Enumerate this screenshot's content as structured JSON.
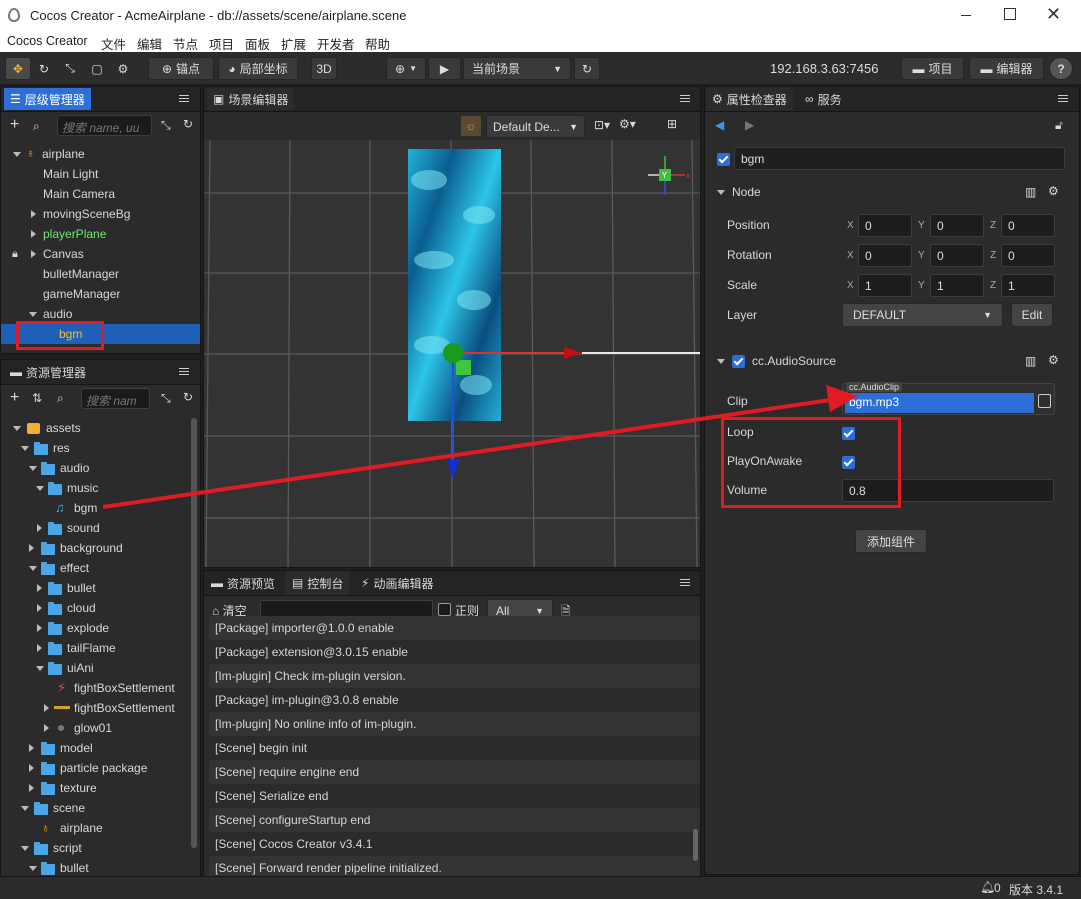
{
  "window": {
    "title": "Cocos Creator - AcmeAirplane - db://assets/scene/airplane.scene"
  },
  "menu": [
    "Cocos Creator",
    "文件",
    "编辑",
    "节点",
    "项目",
    "面板",
    "扩展",
    "开发者",
    "帮助"
  ],
  "toolbar": {
    "anchor": "锚点",
    "local_coords": "局部坐标",
    "mode3d": "3D",
    "scene_select": "当前场景",
    "ip": "192.168.3.63:7456",
    "project": "项目",
    "editor": "编辑器",
    "help": "?"
  },
  "hierarchy": {
    "tab": "层级管理器",
    "search_placeholder": "搜索 name, uu",
    "root": "airplane",
    "items": [
      {
        "label": "Main Light"
      },
      {
        "label": "Main Camera"
      },
      {
        "label": "movingSceneBg"
      },
      {
        "label": "playerPlane"
      },
      {
        "label": "Canvas"
      },
      {
        "label": "bulletManager"
      },
      {
        "label": "gameManager"
      },
      {
        "label": "audio"
      },
      {
        "label": "bgm"
      }
    ]
  },
  "assets": {
    "tab": "资源管理器",
    "search_placeholder": "搜索 nam",
    "items": [
      {
        "label": "assets"
      },
      {
        "label": "res"
      },
      {
        "label": "audio"
      },
      {
        "label": "music"
      },
      {
        "label": "bgm"
      },
      {
        "label": "sound"
      },
      {
        "label": "background"
      },
      {
        "label": "effect"
      },
      {
        "label": "bullet"
      },
      {
        "label": "cloud"
      },
      {
        "label": "explode"
      },
      {
        "label": "tailFlame"
      },
      {
        "label": "uiAni"
      },
      {
        "label": "fightBoxSettlement"
      },
      {
        "label": "fightBoxSettlement"
      },
      {
        "label": "glow01"
      },
      {
        "label": "model"
      },
      {
        "label": "particle package"
      },
      {
        "label": "texture"
      },
      {
        "label": "scene"
      },
      {
        "label": "airplane"
      },
      {
        "label": "script"
      },
      {
        "label": "bullet"
      }
    ]
  },
  "scene_editor": {
    "tab": "场景编辑器",
    "camera_select": "Default De..."
  },
  "bottom": {
    "tabs": [
      "资源预览",
      "控制台",
      "动画编辑器"
    ],
    "clear": "清空",
    "regex": "正则",
    "filter": "All",
    "logs": [
      "[Package] importer@1.0.0 enable",
      "[Package] extension@3.0.15 enable",
      "[Im-plugin] Check im-plugin version.",
      "[Package] im-plugin@3.0.8 enable",
      "[Im-plugin] No online info of im-plugin.",
      "[Scene] begin init",
      "[Scene] require engine end",
      "[Scene] Serialize end",
      "[Scene] configureStartup end",
      "[Scene] Cocos Creator v3.4.1",
      "[Scene] Forward render pipeline initialized."
    ]
  },
  "inspector": {
    "tabs": [
      "属性检查器",
      "服务"
    ],
    "node_name": "bgm",
    "node_section": "Node",
    "position": {
      "label": "Position",
      "x": "0",
      "y": "0",
      "z": "0"
    },
    "rotation": {
      "label": "Rotation",
      "x": "0",
      "y": "0",
      "z": "0"
    },
    "scale": {
      "label": "Scale",
      "x": "1",
      "y": "1",
      "z": "1"
    },
    "layer": {
      "label": "Layer",
      "value": "DEFAULT",
      "edit": "Edit"
    },
    "audio_section": "cc.AudioSource",
    "clip": {
      "label": "Clip",
      "type": "cc.AudioClip",
      "value": "bgm.mp3"
    },
    "loop": {
      "label": "Loop",
      "checked": true
    },
    "play_on_awake": {
      "label": "PlayOnAwake",
      "checked": true
    },
    "volume": {
      "label": "Volume",
      "value": "0.8"
    },
    "add_component": "添加组件"
  },
  "axis_letters": {
    "x": "X",
    "y": "Y",
    "z": "Z"
  },
  "status": {
    "notifications": "0",
    "version": "版本 3.4.1"
  },
  "colors": {
    "accent": "#2d6fd6",
    "highlight_red": "#e01b24",
    "node_green": "#6fe56f",
    "folder": "#4aa6e8"
  }
}
